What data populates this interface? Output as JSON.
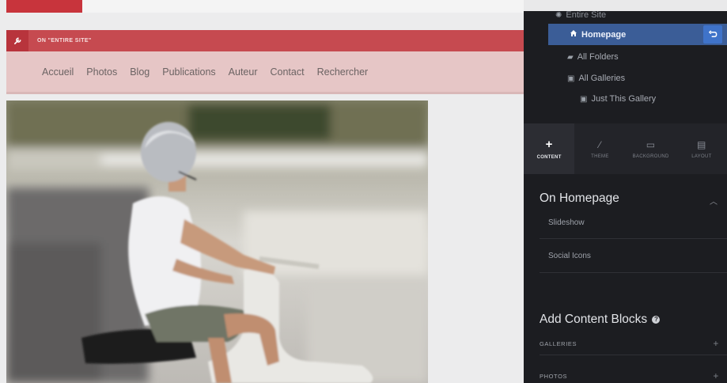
{
  "banner": {
    "text": "ON \"ENTIRE SITE\""
  },
  "nav": [
    "Accueil",
    "Photos",
    "Blog",
    "Publications",
    "Auteur",
    "Contact",
    "Rechercher"
  ],
  "panel": {
    "tree": {
      "entire_site": "Entire Site",
      "homepage": "Homepage",
      "all_folders": "All Folders",
      "all_galleries": "All Galleries",
      "just_this_gallery": "Just This Gallery"
    },
    "tabs": [
      "CONTENT",
      "THEME",
      "BACKGROUND",
      "LAYOUT"
    ],
    "on_homepage_title": "On Homepage",
    "on_homepage_items": [
      "Slideshow",
      "Social Icons"
    ],
    "add_blocks_title": "Add Content Blocks",
    "categories": [
      "GALLERIES",
      "PHOTOS"
    ]
  },
  "colors": {
    "accent_red": "#c64a50",
    "panel_bg": "#1c1d21",
    "selected_blue": "#3b5d97",
    "undo_blue": "#3f73c9"
  },
  "icons": {
    "banner": "wrench-icon",
    "homepage": "home-icon",
    "folders": "folder-icon",
    "galleries": "gallery-icon",
    "undo": "undo-icon"
  }
}
